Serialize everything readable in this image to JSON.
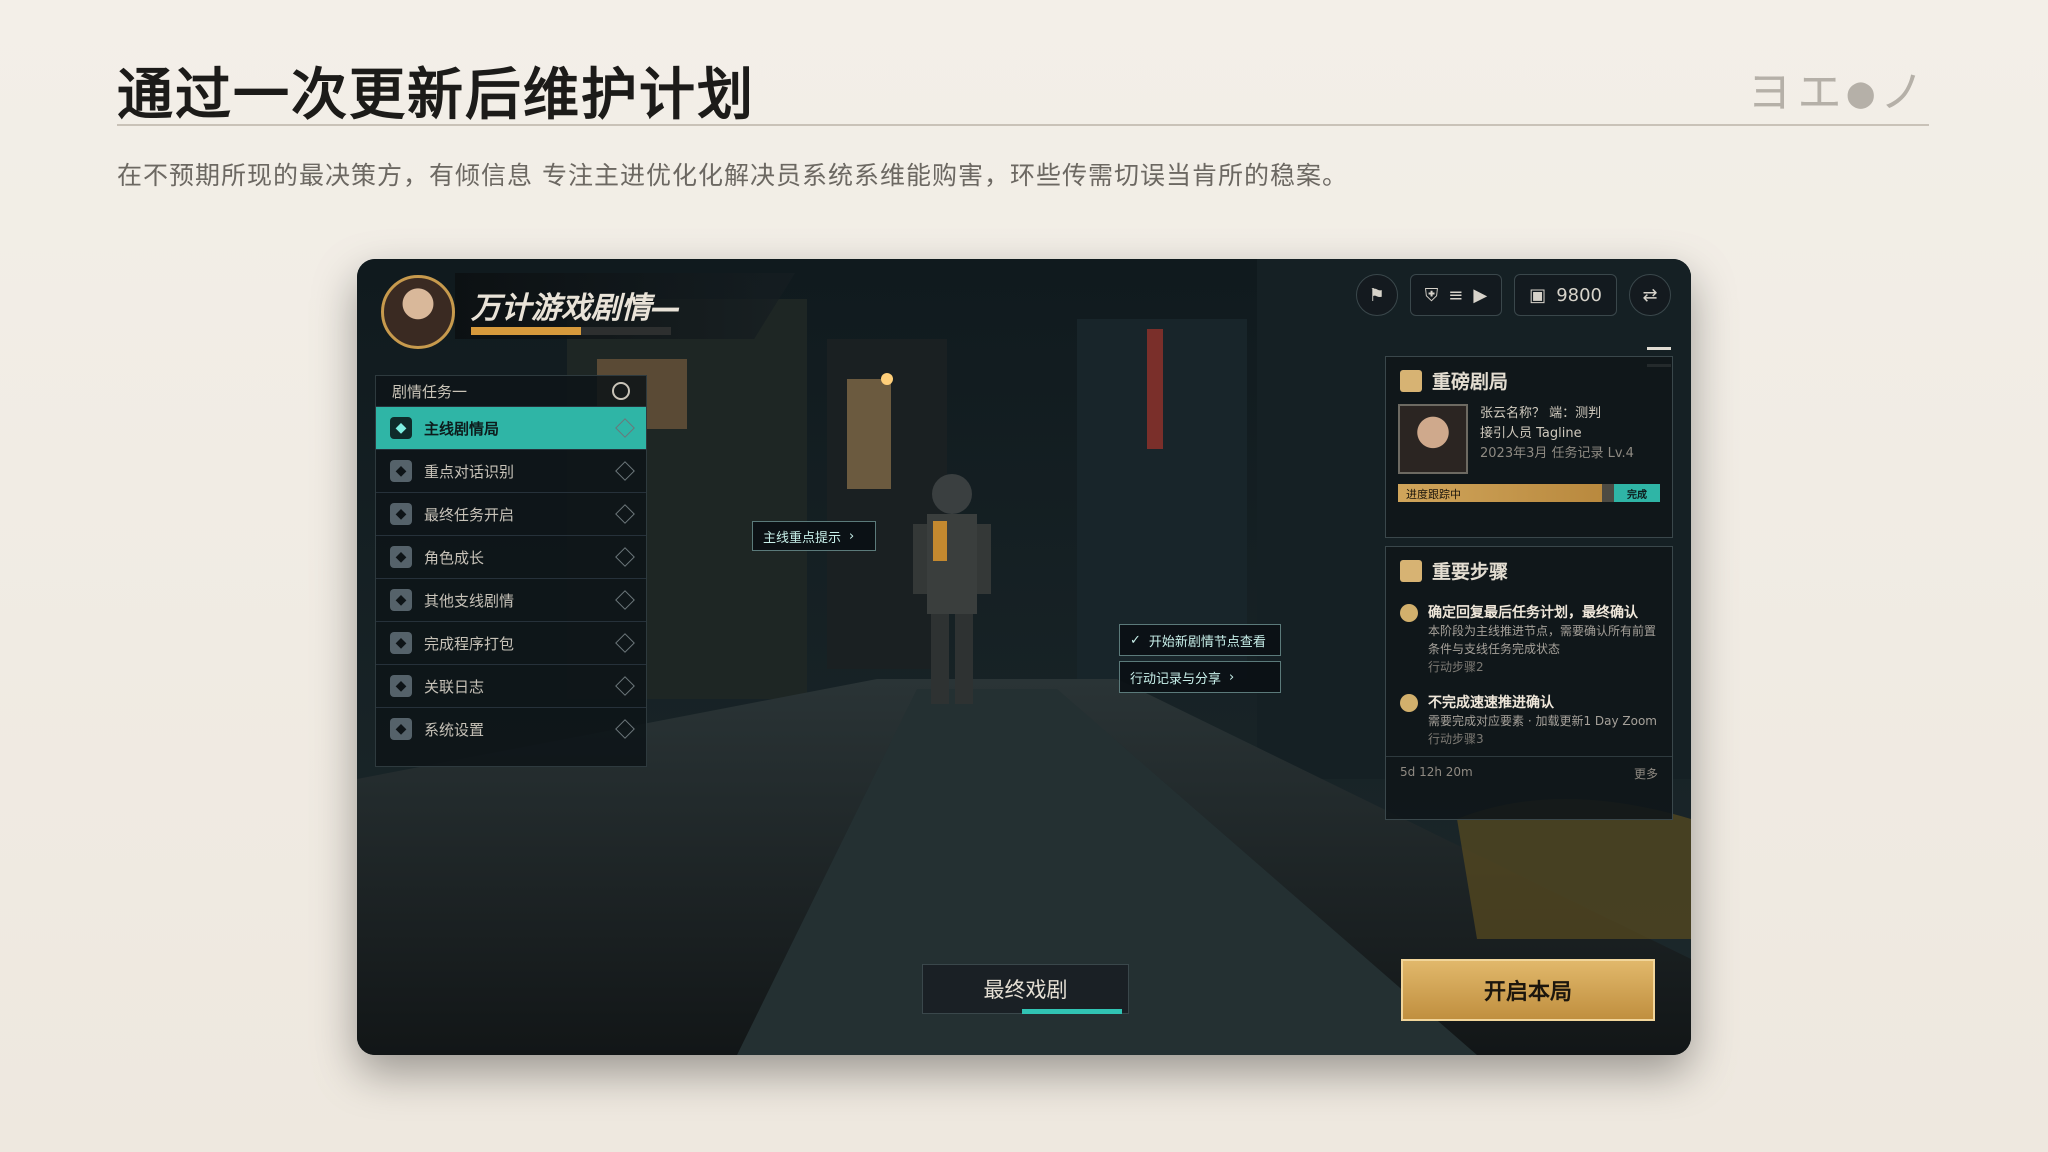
{
  "slide": {
    "title": "通过一次更新后维护计划",
    "page_indicator": "ヨエ●ノ",
    "subtitle": "在不预期所现的最决策方，有倾信息 专注主进优化化解决员系统系维能购害，环些传需切误当肯所的稳案。"
  },
  "game_ui": {
    "player_name": "万计游戏剧情—",
    "xp_fraction": 0.55,
    "hud": {
      "icon_left": "faction-emblem-icon",
      "chip_icons": [
        "shield-icon",
        "menu-icon",
        "play-icon"
      ],
      "currency_value": "9800",
      "currency_icon": "wallet-icon",
      "share_icon": "share-icon"
    },
    "left_menu": {
      "header": "剧情任务一",
      "items": [
        {
          "label": "主线剧情局",
          "icon": "book-icon",
          "active": true
        },
        {
          "label": "重点对话识别",
          "icon": "chat-icon",
          "active": false
        },
        {
          "label": "最终任务开启",
          "icon": "flag-icon",
          "active": false
        },
        {
          "label": "角色成长",
          "icon": "person-icon",
          "active": false
        },
        {
          "label": "其他支线剧情",
          "icon": "map-icon",
          "active": false
        },
        {
          "label": "完成程序打包",
          "icon": "edit-icon",
          "active": false
        },
        {
          "label": "关联日志",
          "icon": "mail-icon",
          "active": false
        },
        {
          "label": "系统设置",
          "icon": "settings-icon",
          "active": false
        }
      ]
    },
    "tooltips": [
      {
        "label": "主线重点提示",
        "icon": "arrow-icon"
      },
      {
        "label": "开始新剧情节点查看",
        "icon": "check-icon"
      },
      {
        "label": "行动记录与分享",
        "icon": "arrow-icon"
      }
    ],
    "quest_panel": {
      "title": "重磅剧局",
      "npc_name": "张云名称？ 端：测判",
      "npc_role": "接引人员 Tagline",
      "npc_meta": "2023年3月 任务记录 Lv.4",
      "progress_fraction": 0.78,
      "progress_label": "进度跟踪中",
      "progress_tag": "完成"
    },
    "steps_panel": {
      "title": "重要步骤",
      "steps": [
        {
          "title": "确定回复最后任务计划，最终确认",
          "detail": "本阶段为主线推进节点，需要确认所有前置条件与支线任务完成状态",
          "meta": "行动步骤2"
        },
        {
          "title": "不完成速速推进确认",
          "detail": "需要完成对应要素 · 加载更新1 Day Zoom",
          "meta": "行动步骤3"
        }
      ],
      "footer_left": "5d 12h 20m",
      "footer_right": "更多"
    },
    "bottom_tab": "最终戏剧",
    "cta": "开启本局"
  }
}
